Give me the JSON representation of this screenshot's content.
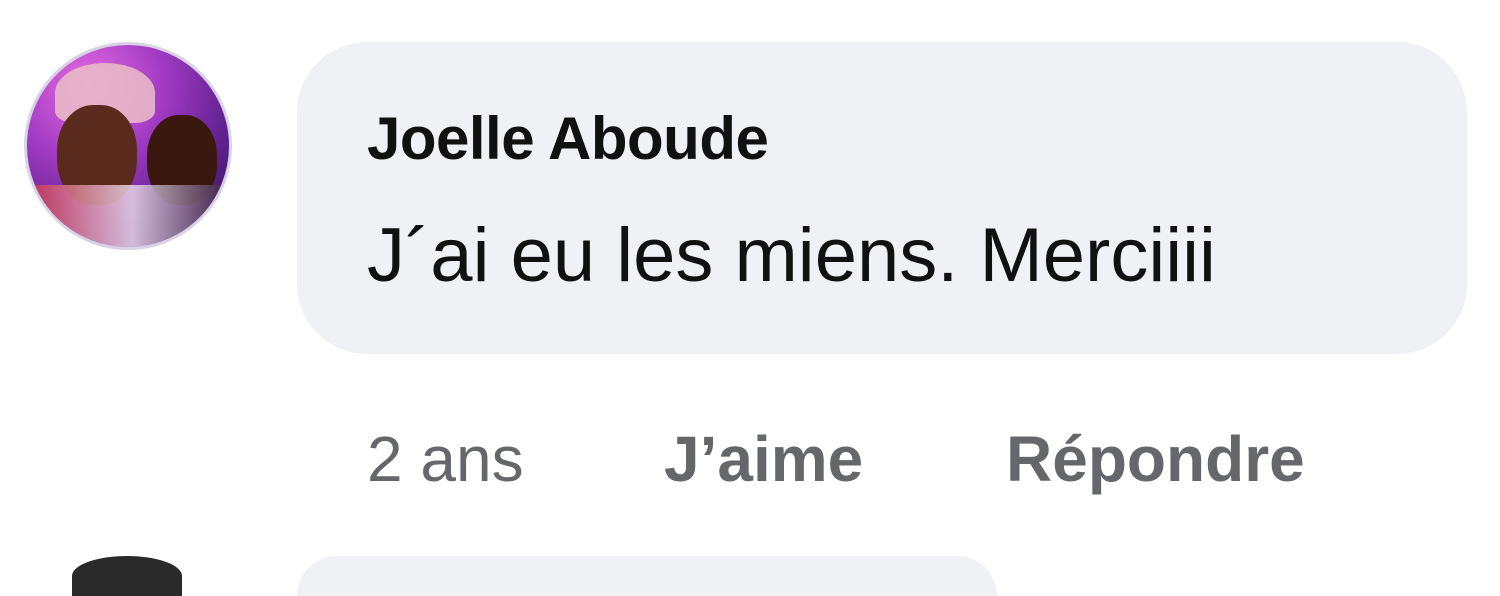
{
  "comment": {
    "author": "Joelle Aboude",
    "text": "J´ai eu les miens. Merciiii",
    "time": "2 ans",
    "like_label": "J’aime",
    "reply_label": "Répondre"
  }
}
